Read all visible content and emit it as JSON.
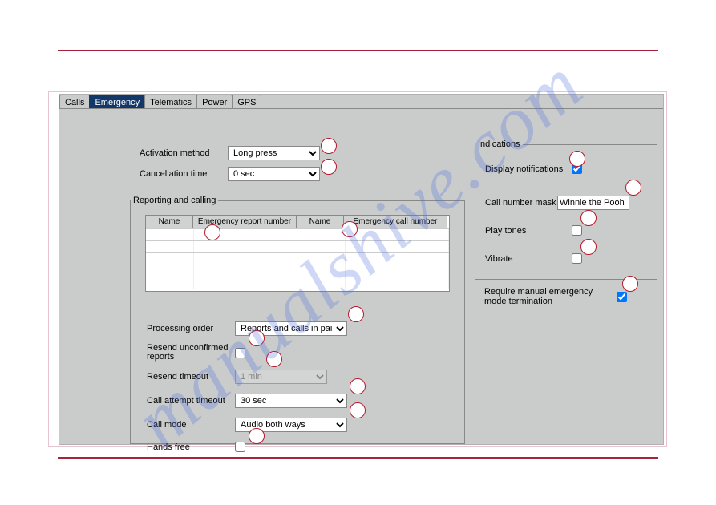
{
  "tabs": [
    "Calls",
    "Emergency",
    "Telematics",
    "Power",
    "GPS"
  ],
  "active_tab_index": 1,
  "left": {
    "activation_method": {
      "label": "Activation method",
      "value": "Long press"
    },
    "cancellation_time": {
      "label": "Cancellation time",
      "value": "0 sec"
    }
  },
  "reporting": {
    "legend": "Reporting and calling",
    "columns": [
      "Name",
      "Emergency report number",
      "Name",
      "Emergency call number"
    ],
    "processing_order": {
      "label": "Processing order",
      "value": "Reports and calls in pairs"
    },
    "resend_unconfirmed": {
      "label": "Resend unconfirmed reports",
      "checked": false
    },
    "resend_timeout": {
      "label": "Resend timeout",
      "value": "1 min",
      "disabled": true
    },
    "call_attempt_timeout": {
      "label": "Call attempt timeout",
      "value": "30 sec"
    },
    "call_mode": {
      "label": "Call mode",
      "value": "Audio both ways"
    },
    "hands_free": {
      "label": "Hands free",
      "checked": false
    }
  },
  "indications": {
    "legend": "Indications",
    "display_notifications": {
      "label": "Display notifications",
      "checked": true
    },
    "call_number_mask": {
      "label": "Call number mask",
      "value": "Winnie the Pooh"
    },
    "play_tones": {
      "label": "Play tones",
      "checked": false
    },
    "vibrate": {
      "label": "Vibrate",
      "checked": false
    }
  },
  "require_manual": {
    "label": "Require manual emergency mode termination",
    "checked": true
  },
  "watermark": "manualshive.com"
}
